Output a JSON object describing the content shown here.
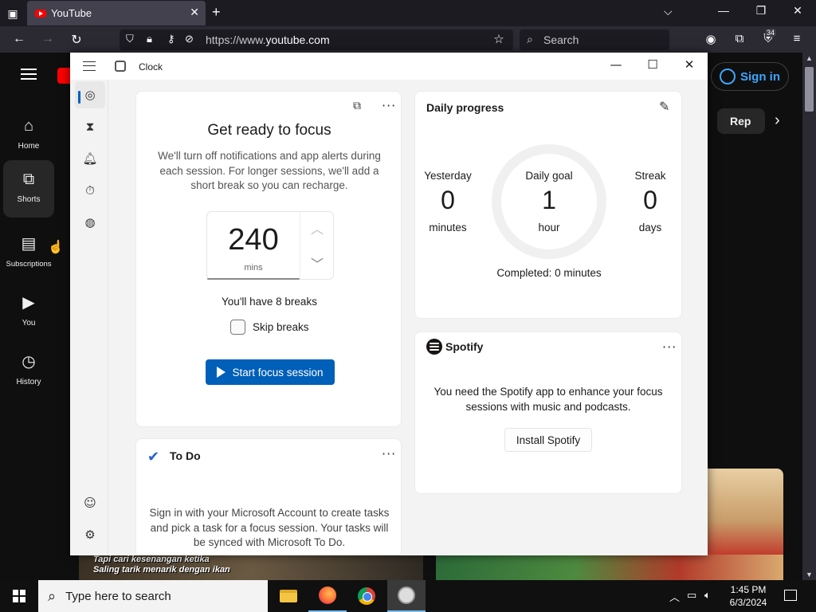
{
  "browser": {
    "tab": {
      "title": "YouTube"
    },
    "url": {
      "prefix": "https://www.",
      "host": "youtube.com"
    },
    "search_placeholder": "Search",
    "extension_badge": "34"
  },
  "youtube": {
    "nav": [
      {
        "label": "Home",
        "icon": "home-icon"
      },
      {
        "label": "Shorts",
        "icon": "shorts-icon"
      },
      {
        "label": "Subscriptions",
        "icon": "subscriptions-icon"
      },
      {
        "label": "You",
        "icon": "you-icon"
      },
      {
        "label": "History",
        "icon": "history-icon"
      }
    ],
    "sign_in": "Sign in",
    "chip": "Rep",
    "thumb_caption": "Tapi cari kesenangan ketika\nSaling tarik menarik dengan ikan"
  },
  "clock": {
    "title": "Clock",
    "focus": {
      "title": "Get ready to focus",
      "description": "We'll turn off notifications and app alerts during each session. For longer sessions, we'll add a short break so you can recharge.",
      "minutes": "240",
      "unit": "mins",
      "breaks": "You'll have 8 breaks",
      "skip_breaks": "Skip breaks",
      "skip_checked": false,
      "start": "Start focus session"
    },
    "todo": {
      "title": "To Do",
      "description": "Sign in with your Microsoft Account to create tasks and pick a task for a focus session. Your tasks will be synced with Microsoft To Do."
    },
    "progress": {
      "title": "Daily progress",
      "yesterday": {
        "label": "Yesterday",
        "value": "0",
        "unit": "minutes"
      },
      "goal": {
        "label": "Daily goal",
        "value": "1",
        "unit": "hour"
      },
      "streak": {
        "label": "Streak",
        "value": "0",
        "unit": "days"
      },
      "completed": "Completed: 0 minutes"
    },
    "spotify": {
      "name": "Spotify",
      "description": "You need the Spotify app to enhance your focus sessions with music and podcasts.",
      "install": "Install Spotify"
    }
  },
  "taskbar": {
    "search_placeholder": "Type here to search",
    "time": "1:45 PM",
    "date": "6/3/2024"
  },
  "colors": {
    "accent": "#005fb8",
    "youtube_red": "#ff0000",
    "signin_blue": "#3ea6ff"
  }
}
